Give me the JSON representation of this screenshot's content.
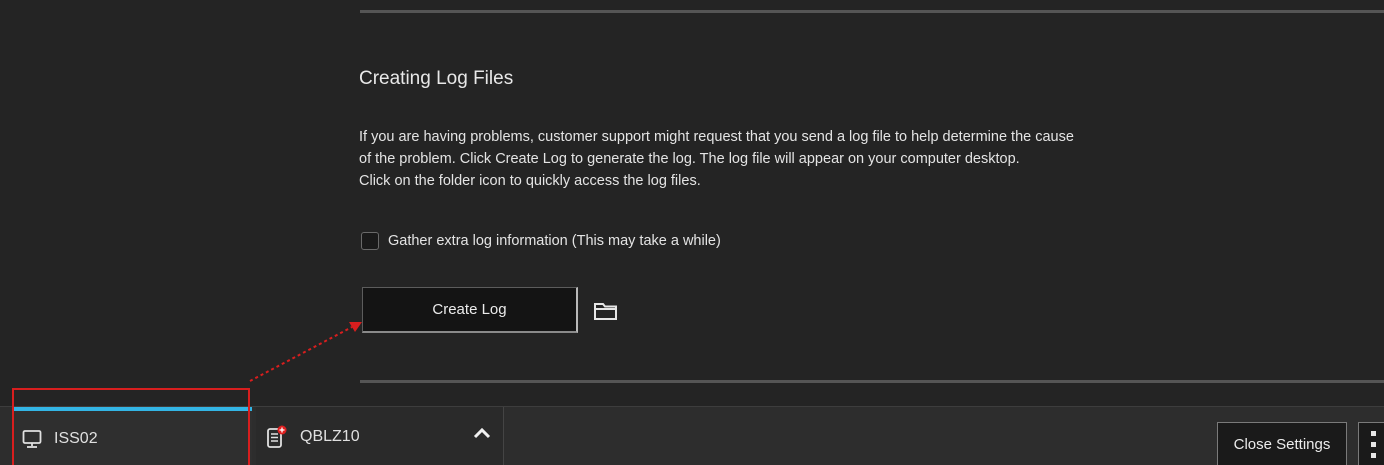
{
  "log_section": {
    "title": "Creating Log Files",
    "description_lines": [
      "If you are having problems, customer support might request that you send a log file to help determine the cause",
      "of the problem. Click Create Log to generate the log. The log file will appear on your computer desktop.",
      "Click on the folder icon to quickly access the log files."
    ],
    "gather_checkbox": {
      "label": "Gather extra log information (This may take a while)",
      "checked": false
    },
    "create_log_label": "Create Log",
    "folder_icon": "folder-icon"
  },
  "taskbar": {
    "tabs": [
      {
        "label": "ISS02",
        "icon": "monitor-icon",
        "active": true
      },
      {
        "label": "QBLZ10",
        "icon": "phone-device-icon",
        "active": false
      }
    ],
    "expand_icon": "chevron-up-icon",
    "close_settings_label": "Close Settings",
    "more_icon": "more-vertical-icon"
  },
  "colors": {
    "background": "#242424",
    "active_tab_accent": "#33b5e5",
    "annotation_red": "#d81e1e",
    "badge_red": "#e02020"
  }
}
